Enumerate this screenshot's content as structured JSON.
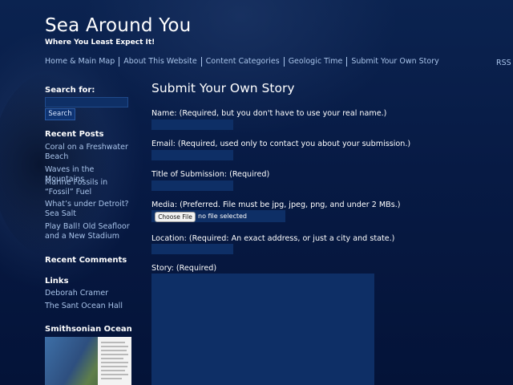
{
  "site": {
    "title": "Sea Around You",
    "tagline": "Where You Least Expect It!"
  },
  "nav": {
    "items": [
      "Home & Main Map",
      "About This Website",
      "Content Categories",
      "Geologic Time",
      "Submit Your Own Story"
    ],
    "rss": "RSS"
  },
  "sidebar": {
    "search_label": "Search for:",
    "search_value": "",
    "search_button": "Search",
    "recent_posts_heading": "Recent Posts",
    "recent_posts": [
      "Coral on a Freshwater Beach",
      "Waves in the Mountains",
      "Marine Fossils in “Fossil” Fuel",
      "What’s under Detroit? Sea Salt",
      "Play Ball! Old Seafloor and a New Stadium"
    ],
    "recent_comments_heading": "Recent Comments",
    "links_heading": "Links",
    "links": [
      "Deborah Cramer",
      "The Sant Ocean Hall"
    ],
    "smithsonian_heading": "Smithsonian Ocean"
  },
  "form": {
    "heading": "Submit Your Own Story",
    "name_label": "Name: (Required, but you don't have to use your real name.)",
    "email_label": "Email: (Required, used only to contact you about your submission.)",
    "title_label": "Title of Submission: (Required)",
    "media_label": "Media: (Preferred. File must be jpg, jpeg, png, and under 2 MBs.)",
    "file_button": "Choose File",
    "file_status": "no file selected",
    "location_label": "Location: (Required: An exact address, or just a city and state.)",
    "story_label": "Story: (Required)"
  },
  "colors": {
    "background": "#05163a",
    "link": "#a9c4ea",
    "field": "#0e2f66"
  }
}
